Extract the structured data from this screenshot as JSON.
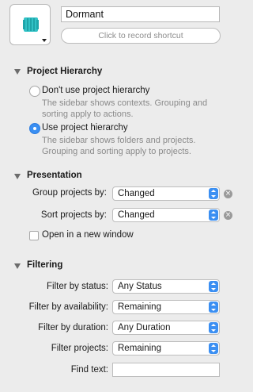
{
  "header": {
    "icon": "tablet-icon",
    "name_value": "Dormant",
    "shortcut_label": "Click to record shortcut"
  },
  "project_hierarchy": {
    "title": "Project Hierarchy",
    "options": [
      {
        "label": "Don't use project hierarchy",
        "desc1": "The sidebar shows contexts. Grouping and",
        "desc2": "sorting apply to actions.",
        "selected": false
      },
      {
        "label": "Use project hierarchy",
        "desc1": "The sidebar shows folders and projects.",
        "desc2": "Grouping and sorting apply to projects.",
        "selected": true
      }
    ]
  },
  "presentation": {
    "title": "Presentation",
    "group_label": "Group projects by:",
    "group_value": "Changed",
    "sort_label": "Sort projects by:",
    "sort_value": "Changed",
    "new_window_label": "Open in a new window",
    "clear_glyph": "×"
  },
  "filtering": {
    "title": "Filtering",
    "status_label": "Filter by status:",
    "status_value": "Any Status",
    "availability_label": "Filter by availability:",
    "availability_value": "Remaining",
    "duration_label": "Filter by duration:",
    "duration_value": "Any Duration",
    "projects_label": "Filter projects:",
    "projects_value": "Remaining",
    "find_label": "Find text:",
    "find_value": ""
  },
  "colors": {
    "accent": "#3b8ff2",
    "background": "#ececec"
  }
}
